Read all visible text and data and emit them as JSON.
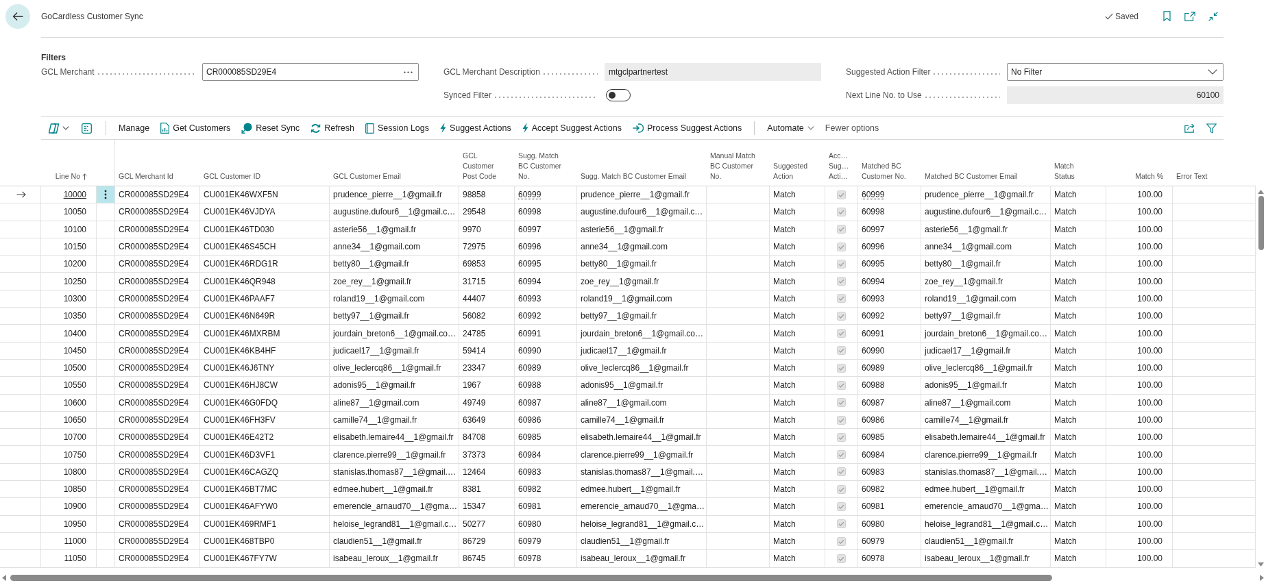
{
  "page": {
    "title": "GoCardless Customer Sync",
    "status": "Saved"
  },
  "filters": {
    "heading": "Filters",
    "columns": [
      [
        {
          "kind": "lookup",
          "label": "GCL Merchant",
          "value": "CR000085SD29E4"
        }
      ],
      [
        {
          "kind": "readonly",
          "label": "GCL Merchant Description",
          "value": "mtgclpartnertest"
        },
        {
          "kind": "toggle",
          "label": "Synced Filter",
          "on": false
        }
      ],
      [
        {
          "kind": "dropdown",
          "label": "Suggested Action Filter",
          "value": "No Filter"
        },
        {
          "kind": "number",
          "label": "Next Line No. to Use",
          "value": "60100"
        }
      ]
    ]
  },
  "action_bar": {
    "actions": [
      {
        "kind": "plain",
        "label": "Manage"
      },
      {
        "kind": "icon",
        "label": "Get Customers"
      },
      {
        "kind": "icon",
        "label": "Reset Sync"
      },
      {
        "kind": "icon",
        "label": "Refresh"
      },
      {
        "kind": "icon",
        "label": "Session Logs"
      },
      {
        "kind": "icon",
        "label": "Suggest Actions"
      },
      {
        "kind": "icon",
        "label": "Accept Suggest Actions"
      },
      {
        "kind": "icon",
        "label": "Process Suggest Actions"
      },
      {
        "kind": "menu",
        "label": "Automate"
      },
      {
        "kind": "link",
        "label": "Fewer options"
      }
    ]
  },
  "table": {
    "columns": [
      {
        "label": "Line No",
        "sorted": true
      },
      {
        "label": "GCL Merchant Id",
        "sorted": false
      },
      {
        "label": "GCL Customer ID",
        "sorted": false
      },
      {
        "label": "GCL Customer Email",
        "sorted": false
      },
      {
        "label": "GCL Customer Post Code",
        "sorted": false
      },
      {
        "label": "Sugg. Match BC Customer No.",
        "sorted": false
      },
      {
        "label": "Sugg. Match BC Customer Email",
        "sorted": false
      },
      {
        "label": "Manual Match BC Customer No.",
        "sorted": false
      },
      {
        "label": "Suggested Action",
        "sorted": false
      },
      {
        "label": "Acc… Sug… Acti…",
        "sorted": false
      },
      {
        "label": "Matched BC Customer No.",
        "sorted": false
      },
      {
        "label": "Matched BC Customer Email",
        "sorted": false
      },
      {
        "label": "Match Status",
        "sorted": false
      },
      {
        "label": "Match %",
        "sorted": false
      },
      {
        "label": "Error Text",
        "sorted": false
      }
    ],
    "rows": [
      {
        "selected": true,
        "line_no": "10000",
        "merchant_id": "CR000085SD29E4",
        "customer_id": "CU001EK46WXF5N",
        "email": "prudence_pierre__1@gmail.fr",
        "post_code": "98858",
        "sugg_no": "60999",
        "sugg_email": "prudence_pierre__1@gmail.fr",
        "suggested_action": "Match",
        "accepted": true,
        "matched_no": "60999",
        "matched_email": "prudence_pierre__1@gmail.fr",
        "match_status": "Match",
        "match_pct": "100.00"
      },
      {
        "selected": false,
        "line_no": "10050",
        "merchant_id": "CR000085SD29E4",
        "customer_id": "CU001EK46VJDYA",
        "email": "augustine.dufour6__1@gmail.c…",
        "post_code": "29548",
        "sugg_no": "60998",
        "sugg_email": "augustine.dufour6__1@gmail.c…",
        "suggested_action": "Match",
        "accepted": true,
        "matched_no": "60998",
        "matched_email": "augustine.dufour6__1@gmail.c…",
        "match_status": "Match",
        "match_pct": "100.00"
      },
      {
        "selected": false,
        "line_no": "10100",
        "merchant_id": "CR000085SD29E4",
        "customer_id": "CU001EK46TD030",
        "email": "asterie56__1@gmail.fr",
        "post_code": "9970",
        "sugg_no": "60997",
        "sugg_email": "asterie56__1@gmail.fr",
        "suggested_action": "Match",
        "accepted": true,
        "matched_no": "60997",
        "matched_email": "asterie56__1@gmail.fr",
        "match_status": "Match",
        "match_pct": "100.00"
      },
      {
        "selected": false,
        "line_no": "10150",
        "merchant_id": "CR000085SD29E4",
        "customer_id": "CU001EK46S45CH",
        "email": "anne34__1@gmail.com",
        "post_code": "72975",
        "sugg_no": "60996",
        "sugg_email": "anne34__1@gmail.com",
        "suggested_action": "Match",
        "accepted": true,
        "matched_no": "60996",
        "matched_email": "anne34__1@gmail.com",
        "match_status": "Match",
        "match_pct": "100.00"
      },
      {
        "selected": false,
        "line_no": "10200",
        "merchant_id": "CR000085SD29E4",
        "customer_id": "CU001EK46RDG1R",
        "email": "betty80__1@gmail.fr",
        "post_code": "69853",
        "sugg_no": "60995",
        "sugg_email": "betty80__1@gmail.fr",
        "suggested_action": "Match",
        "accepted": true,
        "matched_no": "60995",
        "matched_email": "betty80__1@gmail.fr",
        "match_status": "Match",
        "match_pct": "100.00"
      },
      {
        "selected": false,
        "line_no": "10250",
        "merchant_id": "CR000085SD29E4",
        "customer_id": "CU001EK46QR948",
        "email": "zoe_rey__1@gmail.fr",
        "post_code": "31715",
        "sugg_no": "60994",
        "sugg_email": "zoe_rey__1@gmail.fr",
        "suggested_action": "Match",
        "accepted": true,
        "matched_no": "60994",
        "matched_email": "zoe_rey__1@gmail.fr",
        "match_status": "Match",
        "match_pct": "100.00"
      },
      {
        "selected": false,
        "line_no": "10300",
        "merchant_id": "CR000085SD29E4",
        "customer_id": "CU001EK46PAAF7",
        "email": "roland19__1@gmail.com",
        "post_code": "44407",
        "sugg_no": "60993",
        "sugg_email": "roland19__1@gmail.com",
        "suggested_action": "Match",
        "accepted": true,
        "matched_no": "60993",
        "matched_email": "roland19__1@gmail.com",
        "match_status": "Match",
        "match_pct": "100.00"
      },
      {
        "selected": false,
        "line_no": "10350",
        "merchant_id": "CR000085SD29E4",
        "customer_id": "CU001EK46N649R",
        "email": "betty97__1@gmail.fr",
        "post_code": "56082",
        "sugg_no": "60992",
        "sugg_email": "betty97__1@gmail.fr",
        "suggested_action": "Match",
        "accepted": true,
        "matched_no": "60992",
        "matched_email": "betty97__1@gmail.fr",
        "match_status": "Match",
        "match_pct": "100.00"
      },
      {
        "selected": false,
        "line_no": "10400",
        "merchant_id": "CR000085SD29E4",
        "customer_id": "CU001EK46MXRBM",
        "email": "jourdain_breton6__1@gmail.co…",
        "post_code": "24785",
        "sugg_no": "60991",
        "sugg_email": "jourdain_breton6__1@gmail.co…",
        "suggested_action": "Match",
        "accepted": true,
        "matched_no": "60991",
        "matched_email": "jourdain_breton6__1@gmail.co…",
        "match_status": "Match",
        "match_pct": "100.00"
      },
      {
        "selected": false,
        "line_no": "10450",
        "merchant_id": "CR000085SD29E4",
        "customer_id": "CU001EK46KB4HF",
        "email": "judicael17__1@gmail.fr",
        "post_code": "59414",
        "sugg_no": "60990",
        "sugg_email": "judicael17__1@gmail.fr",
        "suggested_action": "Match",
        "accepted": true,
        "matched_no": "60990",
        "matched_email": "judicael17__1@gmail.fr",
        "match_status": "Match",
        "match_pct": "100.00"
      },
      {
        "selected": false,
        "line_no": "10500",
        "merchant_id": "CR000085SD29E4",
        "customer_id": "CU001EK46J6TNY",
        "email": "olive_leclercq86__1@gmail.fr",
        "post_code": "23347",
        "sugg_no": "60989",
        "sugg_email": "olive_leclercq86__1@gmail.fr",
        "suggested_action": "Match",
        "accepted": true,
        "matched_no": "60989",
        "matched_email": "olive_leclercq86__1@gmail.fr",
        "match_status": "Match",
        "match_pct": "100.00"
      },
      {
        "selected": false,
        "line_no": "10550",
        "merchant_id": "CR000085SD29E4",
        "customer_id": "CU001EK46HJ8CW",
        "email": "adonis95__1@gmail.fr",
        "post_code": "1967",
        "sugg_no": "60988",
        "sugg_email": "adonis95__1@gmail.fr",
        "suggested_action": "Match",
        "accepted": true,
        "matched_no": "60988",
        "matched_email": "adonis95__1@gmail.fr",
        "match_status": "Match",
        "match_pct": "100.00"
      },
      {
        "selected": false,
        "line_no": "10600",
        "merchant_id": "CR000085SD29E4",
        "customer_id": "CU001EK46G0FDQ",
        "email": "aline87__1@gmail.com",
        "post_code": "49749",
        "sugg_no": "60987",
        "sugg_email": "aline87__1@gmail.com",
        "suggested_action": "Match",
        "accepted": true,
        "matched_no": "60987",
        "matched_email": "aline87__1@gmail.com",
        "match_status": "Match",
        "match_pct": "100.00"
      },
      {
        "selected": false,
        "line_no": "10650",
        "merchant_id": "CR000085SD29E4",
        "customer_id": "CU001EK46FH3FV",
        "email": "camille74__1@gmail.fr",
        "post_code": "63649",
        "sugg_no": "60986",
        "sugg_email": "camille74__1@gmail.fr",
        "suggested_action": "Match",
        "accepted": true,
        "matched_no": "60986",
        "matched_email": "camille74__1@gmail.fr",
        "match_status": "Match",
        "match_pct": "100.00"
      },
      {
        "selected": false,
        "line_no": "10700",
        "merchant_id": "CR000085SD29E4",
        "customer_id": "CU001EK46E42T2",
        "email": "elisabeth.lemaire44__1@gmail.fr",
        "post_code": "84708",
        "sugg_no": "60985",
        "sugg_email": "elisabeth.lemaire44__1@gmail.fr",
        "suggested_action": "Match",
        "accepted": true,
        "matched_no": "60985",
        "matched_email": "elisabeth.lemaire44__1@gmail.fr",
        "match_status": "Match",
        "match_pct": "100.00"
      },
      {
        "selected": false,
        "line_no": "10750",
        "merchant_id": "CR000085SD29E4",
        "customer_id": "CU001EK46D3VF1",
        "email": "clarence.pierre99__1@gmail.fr",
        "post_code": "37373",
        "sugg_no": "60984",
        "sugg_email": "clarence.pierre99__1@gmail.fr",
        "suggested_action": "Match",
        "accepted": true,
        "matched_no": "60984",
        "matched_email": "clarence.pierre99__1@gmail.fr",
        "match_status": "Match",
        "match_pct": "100.00"
      },
      {
        "selected": false,
        "line_no": "10800",
        "merchant_id": "CR000085SD29E4",
        "customer_id": "CU001EK46CAGZQ",
        "email": "stanislas.thomas87__1@gmail.…",
        "post_code": "12464",
        "sugg_no": "60983",
        "sugg_email": "stanislas.thomas87__1@gmail.…",
        "suggested_action": "Match",
        "accepted": true,
        "matched_no": "60983",
        "matched_email": "stanislas.thomas87__1@gmail.…",
        "match_status": "Match",
        "match_pct": "100.00"
      },
      {
        "selected": false,
        "line_no": "10850",
        "merchant_id": "CR000085SD29E4",
        "customer_id": "CU001EK46BT7MC",
        "email": "edmee.hubert__1@gmail.fr",
        "post_code": "8381",
        "sugg_no": "60982",
        "sugg_email": "edmee.hubert__1@gmail.fr",
        "suggested_action": "Match",
        "accepted": true,
        "matched_no": "60982",
        "matched_email": "edmee.hubert__1@gmail.fr",
        "match_status": "Match",
        "match_pct": "100.00"
      },
      {
        "selected": false,
        "line_no": "10900",
        "merchant_id": "CR000085SD29E4",
        "customer_id": "CU001EK46AFYW0",
        "email": "emerencie_arnaud70__1@gma…",
        "post_code": "15347",
        "sugg_no": "60981",
        "sugg_email": "emerencie_arnaud70__1@gma…",
        "suggested_action": "Match",
        "accepted": true,
        "matched_no": "60981",
        "matched_email": "emerencie_arnaud70__1@gma…",
        "match_status": "Match",
        "match_pct": "100.00"
      },
      {
        "selected": false,
        "line_no": "10950",
        "merchant_id": "CR000085SD29E4",
        "customer_id": "CU001EK469RMF1",
        "email": "heloise_legrand81__1@gmail.c…",
        "post_code": "50277",
        "sugg_no": "60980",
        "sugg_email": "heloise_legrand81__1@gmail.c…",
        "suggested_action": "Match",
        "accepted": true,
        "matched_no": "60980",
        "matched_email": "heloise_legrand81__1@gmail.c…",
        "match_status": "Match",
        "match_pct": "100.00"
      },
      {
        "selected": false,
        "line_no": "11000",
        "merchant_id": "CR000085SD29E4",
        "customer_id": "CU001EK468TBP0",
        "email": "claudien51__1@gmail.fr",
        "post_code": "86729",
        "sugg_no": "60979",
        "sugg_email": "claudien51__1@gmail.fr",
        "suggested_action": "Match",
        "accepted": true,
        "matched_no": "60979",
        "matched_email": "claudien51__1@gmail.fr",
        "match_status": "Match",
        "match_pct": "100.00"
      },
      {
        "selected": false,
        "line_no": "11050",
        "merchant_id": "CR000085SD29E4",
        "customer_id": "CU001EK467FY7W",
        "email": "isabeau_leroux__1@gmail.fr",
        "post_code": "86745",
        "sugg_no": "60978",
        "sugg_email": "isabeau_leroux__1@gmail.fr",
        "suggested_action": "Match",
        "accepted": true,
        "matched_no": "60978",
        "matched_email": "isabeau_leroux__1@gmail.fr",
        "match_status": "Match",
        "match_pct": "100.00"
      }
    ]
  }
}
